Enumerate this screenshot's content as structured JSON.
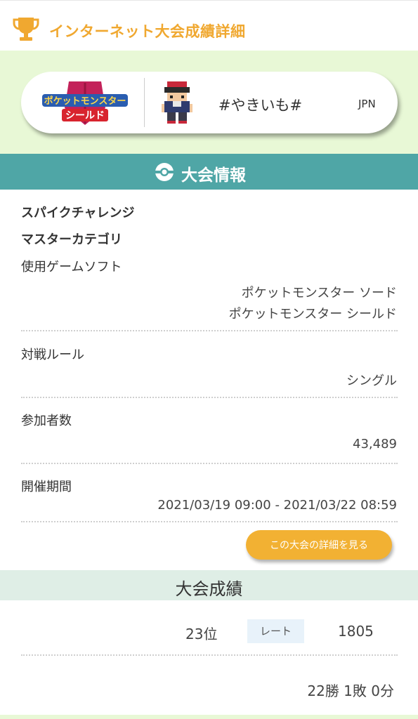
{
  "header": {
    "title": "インターネット大会成績詳細",
    "trophy_icon": "trophy-icon",
    "accent_color": "#f0a830"
  },
  "profile": {
    "logo_icon": "game-logo",
    "logo_line1": "ポケットモンスター",
    "logo_line2": "シールド",
    "avatar_icon": "trainer-avatar",
    "player_name": "#やきいも#",
    "region": "JPN"
  },
  "tournament_info": {
    "section_title": "大会情報",
    "section_icon": "pokeball-icon",
    "name": "スパイクチャレンジ",
    "category": "マスターカテゴリ",
    "software_label": "使用ゲームソフト",
    "software_values": [
      "ポケットモンスター ソード",
      "ポケットモンスター シールド"
    ],
    "rule_label": "対戦ルール",
    "rule_value": "シングル",
    "participants_label": "参加者数",
    "participants_value": "43,489",
    "period_label": "開催期間",
    "period_value": "2021/03/19 09:00 - 2021/03/22 08:59",
    "detail_button": "この大会の詳細を見る"
  },
  "results": {
    "section_title": "大会成績",
    "rank": "23位",
    "rate_label": "レート",
    "rate_value": "1805",
    "record": "22勝 1敗 0分"
  },
  "colors": {
    "teal": "#4fa6a6",
    "light_green": "#e8f8d6",
    "orange_button": "#f2b133",
    "result_bar": "#dfeee6"
  }
}
